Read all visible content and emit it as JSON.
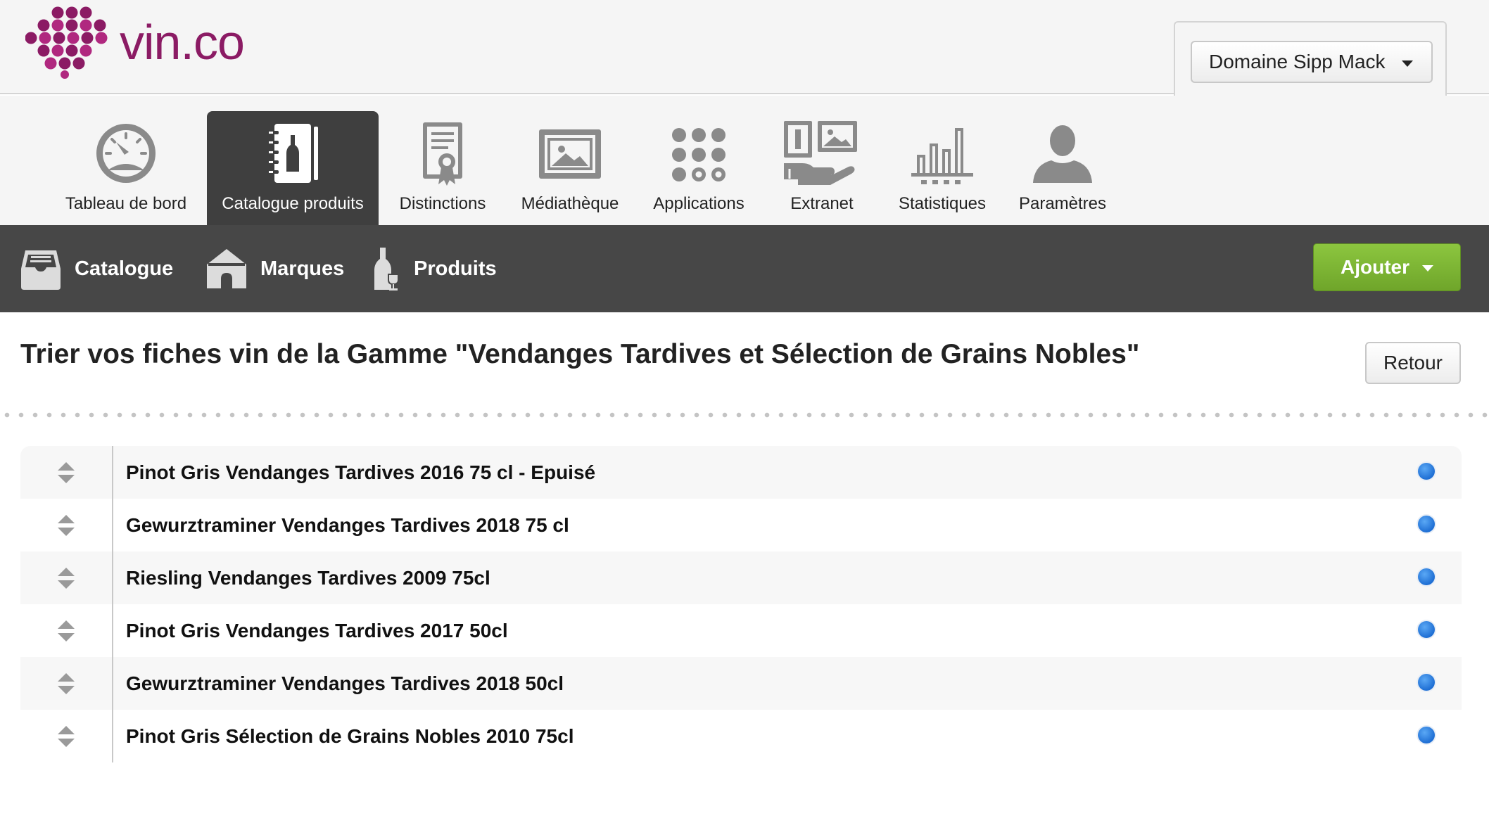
{
  "header": {
    "logo_text_main": "vin",
    "logo_text_dot": ".",
    "logo_text_ext": "co",
    "domain_selector": "Domaine Sipp Mack"
  },
  "modules": [
    {
      "label": "Tableau de bord",
      "icon": "dashboard-gauge-icon",
      "active": false
    },
    {
      "label": "Catalogue produits",
      "icon": "catalog-book-icon",
      "active": true
    },
    {
      "label": "Distinctions",
      "icon": "award-certificate-icon",
      "active": false
    },
    {
      "label": "Médiathèque",
      "icon": "image-gallery-icon",
      "active": false
    },
    {
      "label": "Applications",
      "icon": "apps-grid-icon",
      "active": false
    },
    {
      "label": "Extranet",
      "icon": "extranet-hand-icon",
      "active": false
    },
    {
      "label": "Statistiques",
      "icon": "bar-chart-icon",
      "active": false
    },
    {
      "label": "Paramètres",
      "icon": "user-profile-icon",
      "active": false
    }
  ],
  "subnav": {
    "items": [
      {
        "label": "Catalogue",
        "icon": "inbox-tray-icon"
      },
      {
        "label": "Marques",
        "icon": "house-icon"
      },
      {
        "label": "Produits",
        "icon": "bottle-glass-icon"
      }
    ],
    "add_button": "Ajouter"
  },
  "page": {
    "title": "Trier vos fiches vin de la Gamme \"Vendanges Tardives et Sélection de Grains Nobles\"",
    "back_button": "Retour"
  },
  "sort_list": [
    {
      "label": "Pinot Gris Vendanges Tardives 2016 75 cl - Epuisé"
    },
    {
      "label": "Gewurztraminer Vendanges Tardives 2018 75 cl"
    },
    {
      "label": "Riesling Vendanges Tardives 2009 75cl"
    },
    {
      "label": "Pinot Gris Vendanges Tardives 2017 50cl"
    },
    {
      "label": "Gewurztraminer Vendanges Tardives 2018 50cl"
    },
    {
      "label": "Pinot Gris Sélection de Grains Nobles 2010 75cl"
    }
  ],
  "colors": {
    "brand": "#8b1b64",
    "brand_light": "#b0287f",
    "subnav_bg": "#474747",
    "active_module_bg": "#3f3f3f",
    "add_button": "#7ab833",
    "status_dot": "#1f6fd4",
    "icon_gray": "#8a8a8a"
  }
}
